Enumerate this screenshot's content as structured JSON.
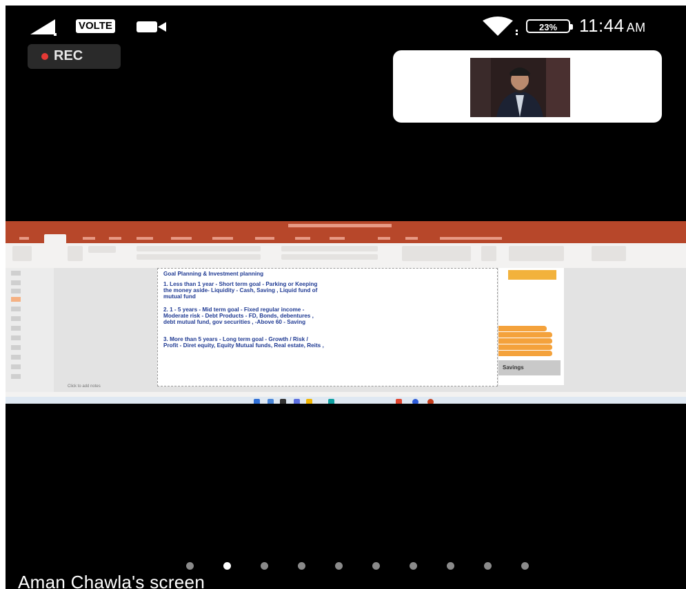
{
  "status_bar": {
    "network_label": "VOLTE",
    "battery": "23%",
    "time": "11:44",
    "ampm": "AM"
  },
  "recording": {
    "label": "REC"
  },
  "shared_screen": {
    "slide_title": "Goal Planning & Investment planning",
    "points": [
      "1. Less than 1 year - Short term goal - Parking or Keeping\nthe money aside- Liquidity - Cash, Saving , Liquid fund of\nmutual fund",
      "2. 1 - 5 years - Mid term goal - Fixed regular income -\nModerate risk - Debt Products - FD, Bonds, debentures ,\ndebt mutual fund, gov securities , -Above 60 - Saving",
      "3. More than 5 years - Long term goal - Growth / Risk /\nProfit - Diret equity, Equity Mutual funds, Real estate, Reits ,"
    ],
    "side_image_label": "Savings",
    "notes_placeholder": "Click to add notes"
  },
  "pagination": {
    "count": 10,
    "active_index": 1
  },
  "caption": "Aman Chawla's screen",
  "colors": {
    "background": "#000000",
    "record_dot": "#e53935",
    "ppt_accent": "#b7472a",
    "slide_text": "#1f3a93"
  }
}
